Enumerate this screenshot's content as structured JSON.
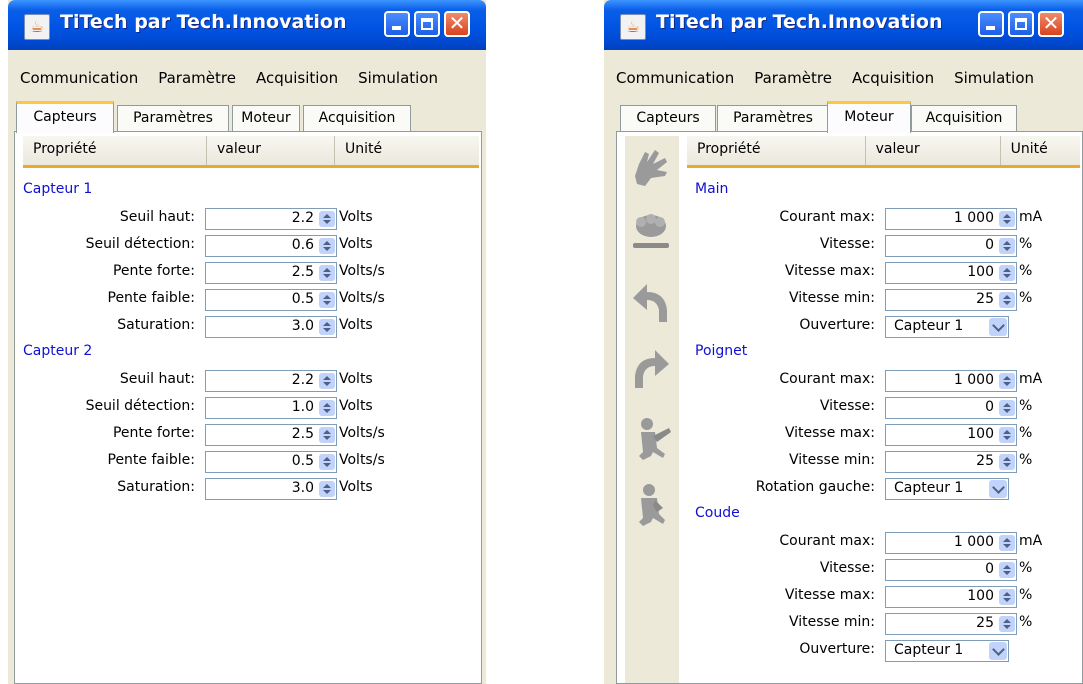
{
  "left": {
    "title": "TiTech par Tech.Innovation",
    "menu": [
      "Communication",
      "Paramètre",
      "Acquisition",
      "Simulation"
    ],
    "tabs": [
      "Capteurs",
      "Paramètres",
      "Moteur",
      "Acquisition"
    ],
    "active_tab": "Capteurs",
    "columns": [
      "Propriété",
      "valeur",
      "Unité"
    ],
    "groups": [
      {
        "name": "Capteur 1",
        "rows": [
          {
            "label": "Seuil haut:",
            "value": "2.2",
            "unit": "Volts"
          },
          {
            "label": "Seuil détection:",
            "value": "0.6",
            "unit": "Volts"
          },
          {
            "label": "Pente forte:",
            "value": "2.5",
            "unit": "Volts/s"
          },
          {
            "label": "Pente faible:",
            "value": "0.5",
            "unit": "Volts/s"
          },
          {
            "label": "Saturation:",
            "value": "3.0",
            "unit": "Volts"
          }
        ]
      },
      {
        "name": "Capteur 2",
        "rows": [
          {
            "label": "Seuil haut:",
            "value": "2.2",
            "unit": "Volts"
          },
          {
            "label": "Seuil détection:",
            "value": "1.0",
            "unit": "Volts"
          },
          {
            "label": "Pente forte:",
            "value": "2.5",
            "unit": "Volts/s"
          },
          {
            "label": "Pente faible:",
            "value": "0.5",
            "unit": "Volts/s"
          },
          {
            "label": "Saturation:",
            "value": "3.0",
            "unit": "Volts"
          }
        ]
      }
    ]
  },
  "right": {
    "title": "TiTech par Tech.Innovation",
    "menu": [
      "Communication",
      "Paramètre",
      "Acquisition",
      "Simulation"
    ],
    "tabs": [
      "Capteurs",
      "Paramètres",
      "Moteur",
      "Acquisition"
    ],
    "active_tab": "Moteur",
    "columns": [
      "Propriété",
      "valeur",
      "Unité"
    ],
    "side_icons": [
      "hand-open-icon",
      "hand-closed-icon",
      "rotate-left-icon",
      "rotate-right-icon",
      "arm-extend-icon",
      "arm-flex-icon"
    ],
    "groups": [
      {
        "name": "Main",
        "rows": [
          {
            "label": "Courant max:",
            "value": "1 000",
            "unit": "mA",
            "kind": "spin"
          },
          {
            "label": "Vitesse:",
            "value": "0",
            "unit": "%",
            "kind": "spin"
          },
          {
            "label": "Vitesse max:",
            "value": "100",
            "unit": "%",
            "kind": "spin"
          },
          {
            "label": "Vitesse min:",
            "value": "25",
            "unit": "%",
            "kind": "spin"
          },
          {
            "label": "Ouverture:",
            "value": "Capteur 1",
            "unit": "",
            "kind": "combo"
          }
        ]
      },
      {
        "name": "Poignet",
        "rows": [
          {
            "label": "Courant max:",
            "value": "1 000",
            "unit": "mA",
            "kind": "spin"
          },
          {
            "label": "Vitesse:",
            "value": "0",
            "unit": "%",
            "kind": "spin"
          },
          {
            "label": "Vitesse max:",
            "value": "100",
            "unit": "%",
            "kind": "spin"
          },
          {
            "label": "Vitesse min:",
            "value": "25",
            "unit": "%",
            "kind": "spin"
          },
          {
            "label": "Rotation gauche:",
            "value": "Capteur 1",
            "unit": "",
            "kind": "combo"
          }
        ]
      },
      {
        "name": "Coude",
        "rows": [
          {
            "label": "Courant max:",
            "value": "1 000",
            "unit": "mA",
            "kind": "spin"
          },
          {
            "label": "Vitesse:",
            "value": "0",
            "unit": "%",
            "kind": "spin"
          },
          {
            "label": "Vitesse max:",
            "value": "100",
            "unit": "%",
            "kind": "spin"
          },
          {
            "label": "Vitesse min:",
            "value": "25",
            "unit": "%",
            "kind": "spin"
          },
          {
            "label": "Ouverture:",
            "value": "Capteur 1",
            "unit": "",
            "kind": "combo"
          }
        ]
      }
    ]
  }
}
